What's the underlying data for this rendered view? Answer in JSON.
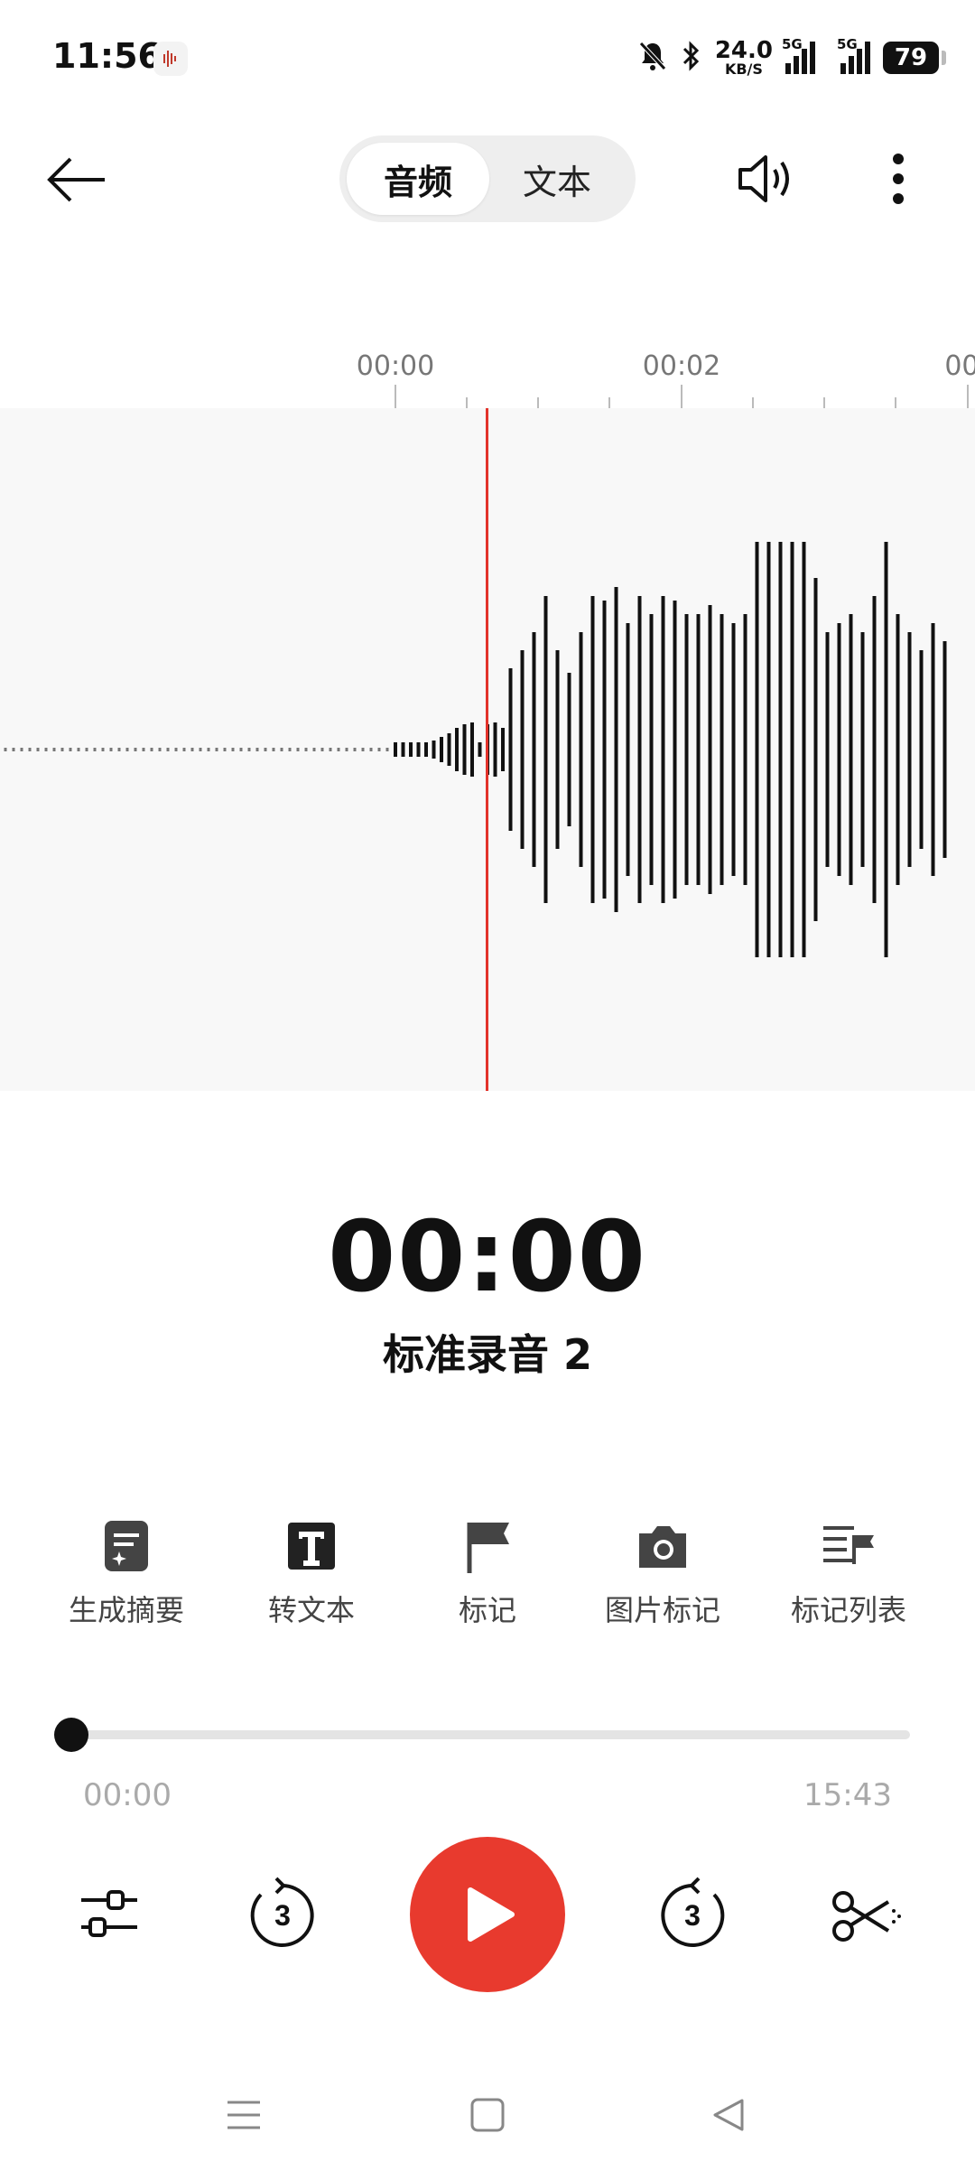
{
  "status_bar": {
    "time": "11:56",
    "net_speed_value": "24.0",
    "net_speed_unit": "KB/S",
    "signal1_label": "5G",
    "signal2_label": "5G",
    "battery": "79"
  },
  "header": {
    "tabs": [
      {
        "label": "音频",
        "active": true
      },
      {
        "label": "文本",
        "active": false
      }
    ]
  },
  "timeline": {
    "ruler_labels": [
      "00:00",
      "00:02",
      "00:0"
    ],
    "accent_color": "#e2332b"
  },
  "playback": {
    "current_time": "00:00",
    "recording_title": "标准录音 2",
    "start_time": "00:00",
    "end_time": "15:43",
    "progress": 0.0,
    "skip_back_seconds": "3",
    "skip_forward_seconds": "3",
    "play_color": "#e83a2e"
  },
  "tools": [
    {
      "label": "生成摘要",
      "icon": "summary-doc-icon"
    },
    {
      "label": "转文本",
      "icon": "text-t-icon"
    },
    {
      "label": "标记",
      "icon": "flag-icon"
    },
    {
      "label": "图片标记",
      "icon": "camera-icon"
    },
    {
      "label": "标记列表",
      "icon": "mark-list-icon"
    }
  ]
}
